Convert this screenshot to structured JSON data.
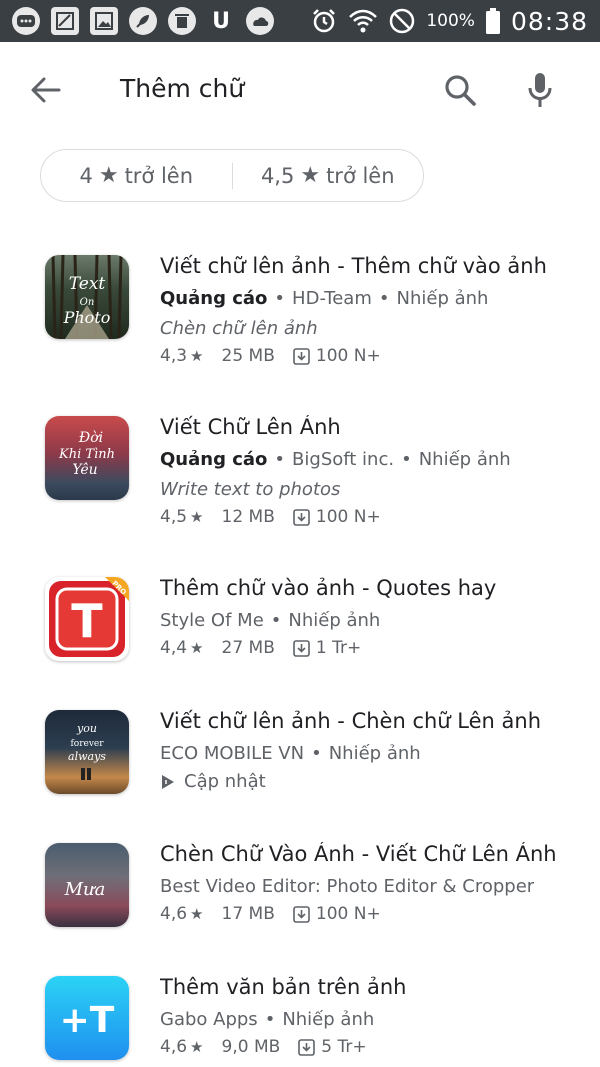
{
  "status_bar": {
    "battery_percent": "100%",
    "time": "08:38",
    "notification_icons": [
      "message-icon",
      "image-edit-icon",
      "gallery-icon",
      "rocket-icon",
      "trash-icon",
      "u-icon",
      "cloud-drive-icon"
    ],
    "system_icons": [
      "alarm-icon",
      "wifi-icon",
      "do-not-disturb-icon",
      "battery-icon"
    ]
  },
  "search": {
    "query": "Thêm chữ"
  },
  "filters": [
    {
      "value": "4",
      "suffix": "trở lên"
    },
    {
      "value": "4,5",
      "suffix": "trở lên"
    }
  ],
  "apps": [
    {
      "title": "Viết chữ lên ảnh - Thêm chữ vào ảnh",
      "ad": "Quảng cáo",
      "developer": "HD-Team",
      "category": "Nhiếp ảnh",
      "description": "Chèn chữ lên ảnh",
      "rating": "4,3",
      "size": "25 MB",
      "downloads": "100 N+",
      "icon_text": [
        "Text",
        "On",
        "Photo"
      ]
    },
    {
      "title": "Viết Chữ Lên Ảnh",
      "ad": "Quảng cáo",
      "developer": "BigSoft inc.",
      "category": "Nhiếp ảnh",
      "description": "Write text to photos",
      "rating": "4,5",
      "size": "12 MB",
      "downloads": "100 N+",
      "icon_text": [
        "Đời",
        "Khi Tình",
        "Yêu"
      ]
    },
    {
      "title": "Thêm chữ vào ảnh - Quotes hay",
      "developer": "Style Of Me",
      "category": "Nhiếp ảnh",
      "rating": "4,4",
      "size": "27 MB",
      "downloads": "1 Tr+",
      "icon_text": [
        "T",
        "PRO"
      ]
    },
    {
      "title": "Viết chữ lên ảnh - Chèn chữ Lên ảnh",
      "developer": "ECO MOBILE VN",
      "category": "Nhiếp ảnh",
      "update_label": "Cập nhật",
      "icon_text": [
        "you",
        "forever",
        "always"
      ]
    },
    {
      "title": "Chèn Chữ Vào Ảnh - Viết Chữ Lên Ảnh",
      "developer": "Best Video Editor: Photo Editor & Cropper",
      "rating": "4,6",
      "size": "17 MB",
      "downloads": "100 N+",
      "icon_text": [
        "Mưa"
      ]
    },
    {
      "title": "Thêm văn bản trên ảnh",
      "developer": "Gabo Apps",
      "category": "Nhiếp ảnh",
      "rating": "4,6",
      "size": "9,0 MB",
      "downloads": "5 Tr+",
      "icon_text": [
        "+T"
      ]
    }
  ],
  "colors": {
    "status_bar_bg": "#3a3f44",
    "text_primary": "#202124",
    "text_secondary": "#5f6368",
    "chip_border": "#dadce0"
  }
}
